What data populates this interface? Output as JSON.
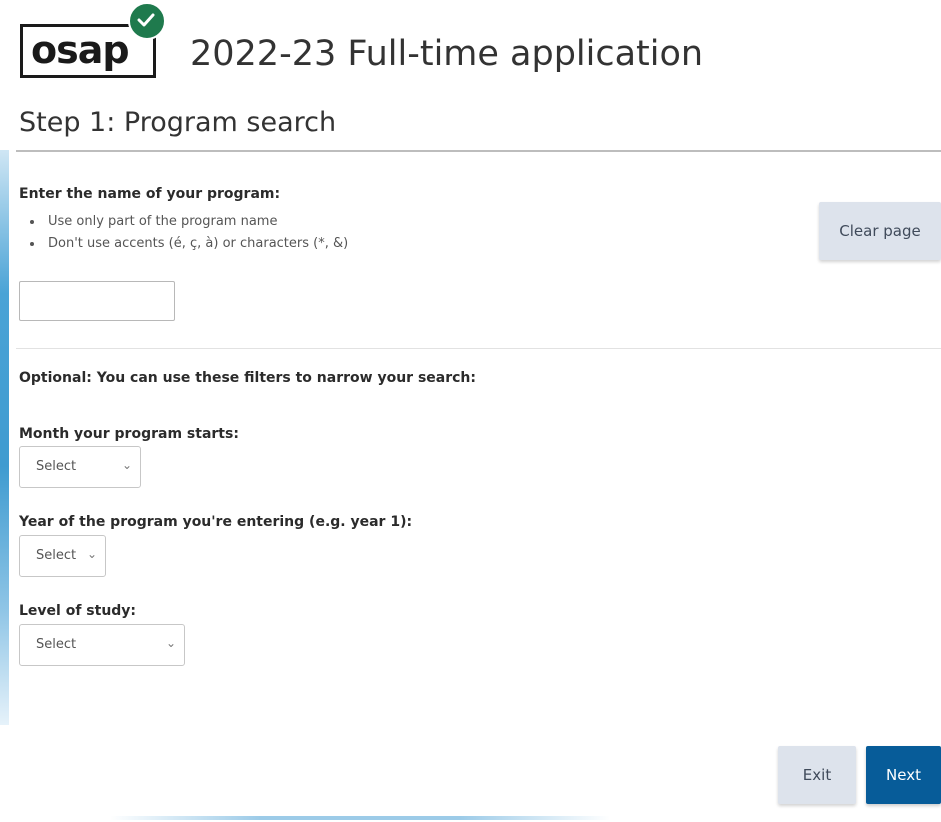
{
  "logo": {
    "text": "osap"
  },
  "header": {
    "title": "2022-23 Full-time application"
  },
  "step": {
    "title": "Step 1: Program search"
  },
  "program_search": {
    "label": "Enter the name of your program:",
    "tips": [
      "Use only part of the program name",
      "Don't use accents (é, ç, à) or characters (*, &)"
    ],
    "input_value": ""
  },
  "clear_button": {
    "label": "Clear page"
  },
  "filters": {
    "intro": "Optional: You can use these filters to narrow your search:",
    "month": {
      "label": "Month your program starts:",
      "selected": "Select"
    },
    "year": {
      "label": "Year of the program you're entering (e.g. year 1):",
      "selected": "Select"
    },
    "level": {
      "label": "Level of study:",
      "selected": "Select"
    }
  },
  "footer": {
    "exit_label": "Exit",
    "next_label": "Next"
  },
  "colors": {
    "primary": "#075c99",
    "secondary_button": "#dde3ec",
    "check_green": "#1f7a4d"
  }
}
